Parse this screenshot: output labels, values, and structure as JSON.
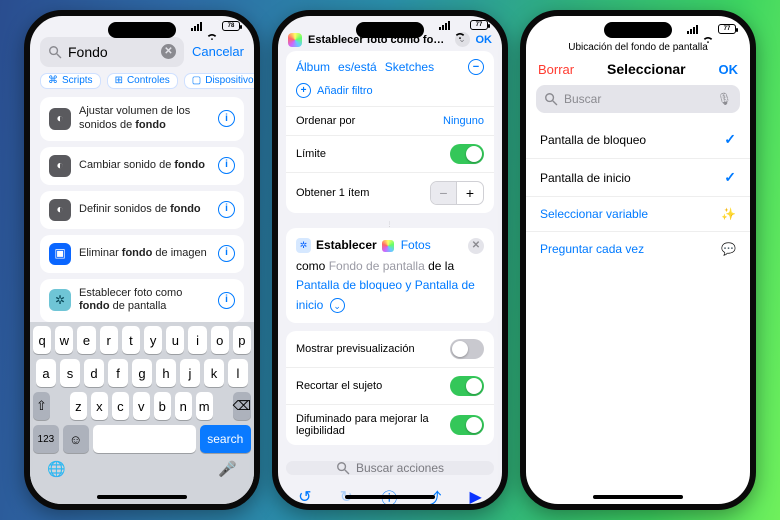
{
  "status": {
    "battery": "78",
    "battery2": "77"
  },
  "colors": {
    "accent": "#007aff"
  },
  "phone1": {
    "search": {
      "value": "Fondo",
      "placeholder": "Buscar"
    },
    "cancel": "Cancelar",
    "chips": [
      {
        "icon": "scripts",
        "label": "Scripts"
      },
      {
        "icon": "controls",
        "label": "Controles"
      },
      {
        "icon": "devices",
        "label": "Dispositivo"
      }
    ],
    "results": [
      {
        "icon_color": "gray",
        "pre": "Ajustar volumen de los sonidos de ",
        "bold": "fondo",
        "post": ""
      },
      {
        "icon_color": "gray",
        "pre": "Cambiar sonido de ",
        "bold": "fondo",
        "post": ""
      },
      {
        "icon_color": "gray",
        "pre": "Definir sonidos de ",
        "bold": "fondo",
        "post": ""
      },
      {
        "icon_color": "blue",
        "pre": "Eliminar ",
        "bold": "fondo",
        "post": " de imagen"
      },
      {
        "icon_color": "teal",
        "pre": "Establecer foto como ",
        "bold": "fondo",
        "post": " de pantalla"
      }
    ],
    "keyboard": {
      "rows": [
        [
          "q",
          "w",
          "e",
          "r",
          "t",
          "y",
          "u",
          "i",
          "o",
          "p"
        ],
        [
          "a",
          "s",
          "d",
          "f",
          "g",
          "h",
          "j",
          "k",
          "l"
        ],
        [
          "z",
          "x",
          "c",
          "v",
          "b",
          "n",
          "m"
        ]
      ],
      "num": "123",
      "search": "search"
    }
  },
  "phone2": {
    "header": {
      "title": "Establecer foto como fondo…",
      "ok": "OK"
    },
    "filters": {
      "tokens": [
        "Álbum",
        "es/está",
        "Sketches"
      ],
      "add_filter": "Añadir filtro",
      "rows": {
        "order_by": {
          "label": "Ordenar por",
          "value": "Ninguno"
        },
        "limit": {
          "label": "Límite",
          "on": true
        },
        "get_item": {
          "label": "Obtener 1 ítem"
        }
      }
    },
    "action": {
      "verb": "Establecer",
      "photos_label": "Fotos",
      "as": "como",
      "wallpaper": "Fondo de pantalla",
      "of": "de la",
      "target": "Pantalla de bloqueo y Pantalla de inicio"
    },
    "options": [
      {
        "label": "Mostrar previsualización",
        "on": false
      },
      {
        "label": "Recortar el sujeto",
        "on": true
      },
      {
        "label": "Difuminado para mejorar la legibilidad",
        "on": true
      }
    ],
    "search_actions": "Buscar acciones"
  },
  "phone3": {
    "sheet_title": "Ubicación del fondo de pantalla",
    "delete": "Borrar",
    "select": "Seleccionar",
    "ok": "OK",
    "search_placeholder": "Buscar",
    "items": [
      {
        "label": "Pantalla de bloqueo",
        "checked": true
      },
      {
        "label": "Pantalla de inicio",
        "checked": true
      }
    ],
    "select_variable": "Seleccionar variable",
    "ask_each_time": "Preguntar cada vez"
  }
}
